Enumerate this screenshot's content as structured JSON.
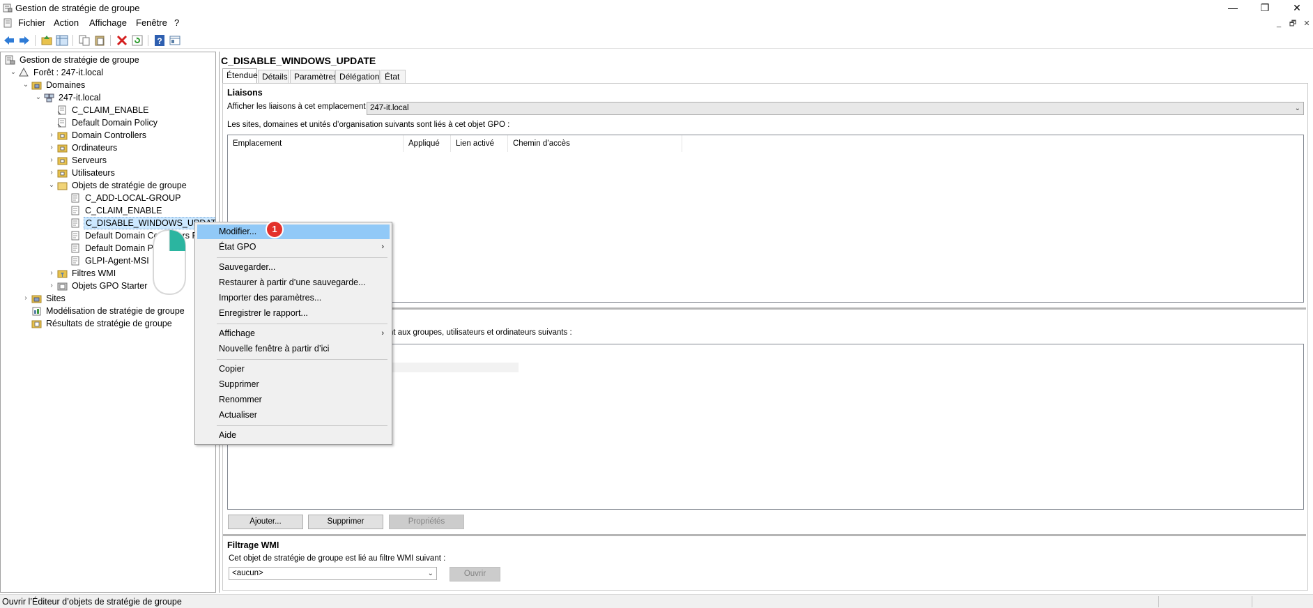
{
  "window": {
    "title": "Gestion de stratégie de groupe",
    "minimize": "—",
    "maximize": "❐",
    "close": "✕"
  },
  "menu": {
    "items": [
      "Fichier",
      "Action",
      "Affichage",
      "Fenêtre",
      "?"
    ],
    "mdi_min": "_",
    "mdi_restore": "🗗",
    "mdi_close": "✕"
  },
  "toolbar": {
    "buttons": [
      "back-icon",
      "forward-icon",
      "up-folder-icon",
      "show-hide-tree-icon",
      "copy-icon",
      "paste-icon",
      "delete-icon",
      "refresh-icon",
      "help-icon",
      "properties-icon"
    ]
  },
  "tree": {
    "root": "Gestion de stratégie de groupe",
    "forest": "Forêt : 247-it.local",
    "domains": "Domaines",
    "domain": "247-it.local",
    "items": [
      "C_CLAIM_ENABLE",
      "Default Domain Policy",
      "Domain Controllers",
      "Ordinateurs",
      "Serveurs",
      "Utilisateurs",
      "Objets de stratégie de groupe"
    ],
    "gpo_items": [
      "C_ADD-LOCAL-GROUP",
      "C_CLAIM_ENABLE",
      "C_DISABLE_WINDOWS_UPDATE",
      "Default Domain Controllers Policy",
      "Default Domain Policy",
      "GLPI-Agent-MSI"
    ],
    "wmi": "Filtres WMI",
    "starter": "Objets GPO Starter",
    "sites": "Sites",
    "modeling": "Modélisation de stratégie de groupe",
    "results": "Résultats de stratégie de groupe"
  },
  "details": {
    "gpo_name": "C_DISABLE_WINDOWS_UPDATE",
    "tabs": [
      "Étendue",
      "Détails",
      "Paramètres",
      "Délégation",
      "État"
    ],
    "links_title": "Liaisons",
    "links_location_label": "Afficher les liaisons à cet emplacement :",
    "links_location_value": "247-it.local",
    "links_desc": "Les sites, domaines et unités d’organisation suivants sont liés à cet objet GPO :",
    "columns": [
      "Emplacement",
      "Appliqué",
      "Lien activé",
      "Chemin d’accès"
    ],
    "security_desc": "ment aux groupes, utilisateurs et ordinateurs suivants :",
    "btn_add": "Ajouter...",
    "btn_remove": "Supprimer",
    "btn_props": "Propriétés",
    "wmi_title": "Filtrage WMI",
    "wmi_desc": "Cet objet de stratégie de groupe est lié au filtre WMI suivant :",
    "wmi_value": "<aucun>",
    "btn_open": "Ouvrir"
  },
  "context_menu": {
    "items": [
      {
        "label": "Modifier...",
        "highlight": true
      },
      {
        "label": "État GPO",
        "submenu": true
      },
      {
        "label": "Sauvegarder..."
      },
      {
        "label": "Restaurer à partir d’une sauvegarde..."
      },
      {
        "label": "Importer des paramètres..."
      },
      {
        "label": "Enregistrer le rapport..."
      },
      {
        "label": "Affichage",
        "submenu": true
      },
      {
        "label": "Nouvelle fenêtre à partir d’ici"
      },
      {
        "label": "Copier"
      },
      {
        "label": "Supprimer"
      },
      {
        "label": "Renommer"
      },
      {
        "label": "Actualiser"
      },
      {
        "label": "Aide"
      }
    ],
    "submenu_glyph": "›"
  },
  "annotation": {
    "badge": "1",
    "badge_color": "#e3312b",
    "mouse_color": "#2bb5a0"
  },
  "status": {
    "text": "Ouvrir l’Éditeur d’objets de stratégie de groupe"
  },
  "colors": {
    "selection": "#cce8ff",
    "menu_highlight": "#91c9f7"
  }
}
